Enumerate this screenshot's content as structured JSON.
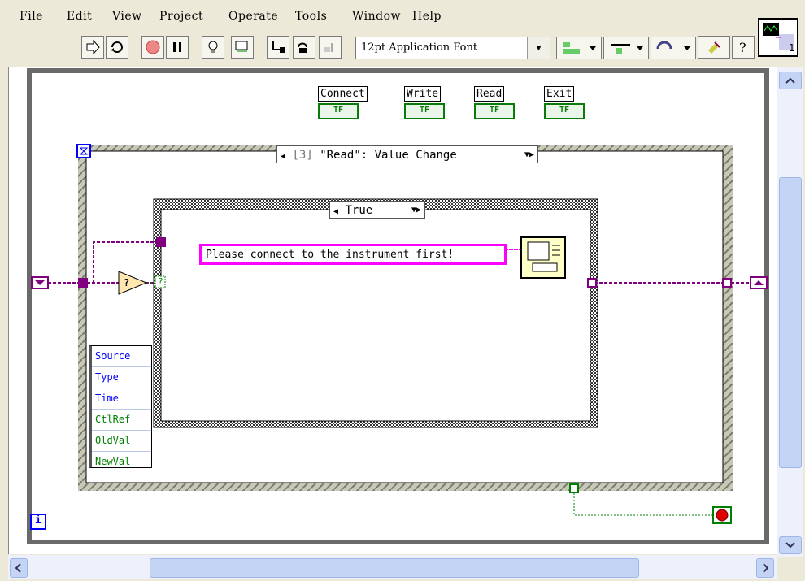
{
  "menu": [
    "File",
    "Edit",
    "View",
    "Project",
    "Operate",
    "Tools",
    "Window",
    "Help"
  ],
  "toolbar": {
    "font_name": "12pt Application Font",
    "conpane_badge": "1"
  },
  "controls": [
    {
      "label": "Connect",
      "tf": "TF"
    },
    {
      "label": "Write",
      "tf": "TF"
    },
    {
      "label": "Read",
      "tf": "TF"
    },
    {
      "label": "Exit",
      "tf": "TF"
    }
  ],
  "event_structure": {
    "selector": "[3] \"Read\": Value Change",
    "selector_index": "[3]",
    "selector_text": "\"Read\": Value Change"
  },
  "case_structure": {
    "selector": "True"
  },
  "message": "Please connect to the instrument first!",
  "compare_symbol": "?",
  "bool_symbol": "?",
  "event_data": [
    "Source",
    "Type",
    "Time",
    "CtlRef",
    "OldVal",
    "NewVal"
  ],
  "colors": {
    "boolean_wire": "#008000",
    "string_wire": "#ff00ff",
    "refnum_wire": "#800080",
    "structure_border": "#3a3a3a",
    "stop_button": "#e00000"
  },
  "icons": {
    "while_loop_iteration": "i",
    "timeout_icon": "hourglass"
  }
}
